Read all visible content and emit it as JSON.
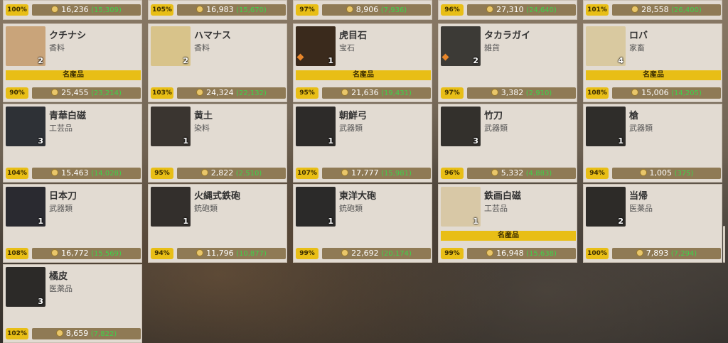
{
  "meisan_label": "名産品",
  "top_row": [
    {
      "pct": "100%",
      "price": "16,236",
      "base": "(15,309)"
    },
    {
      "pct": "105%",
      "price": "16,983",
      "base": "(15,670)"
    },
    {
      "pct": "97%",
      "price": "8,906",
      "base": "(7,936)"
    },
    {
      "pct": "96%",
      "price": "27,310",
      "base": "(24,640)"
    },
    {
      "pct": "101%",
      "price": "28,558",
      "base": "(26,400)"
    }
  ],
  "items": [
    {
      "name": "クチナシ",
      "cat": "香料",
      "count": "2",
      "meisan": true,
      "pct": "90%",
      "price": "25,455",
      "base": "(23,214)",
      "icon": "gardenia-icon",
      "color": "#c9a47a"
    },
    {
      "name": "ハマナス",
      "cat": "香料",
      "count": "2",
      "meisan": false,
      "pct": "103%",
      "price": "24,324",
      "base": "(22,132)",
      "icon": "rose-icon",
      "color": "#d8c38a"
    },
    {
      "name": "虎目石",
      "cat": "宝石",
      "count": "1",
      "meisan": true,
      "pct": "95%",
      "price": "21,636",
      "base": "(19,431)",
      "icon": "tigers-eye-icon",
      "color": "#3a2a1c"
    },
    {
      "name": "タカラガイ",
      "cat": "雑貨",
      "count": "2",
      "meisan": false,
      "pct": "97%",
      "price": "3,382",
      "base": "(2,910)",
      "icon": "cowrie-shell-icon",
      "color": "#3c3a36"
    },
    {
      "name": "ロバ",
      "cat": "家畜",
      "count": "4",
      "meisan": true,
      "pct": "108%",
      "price": "15,006",
      "base": "(14,205)",
      "icon": "donkey-icon",
      "color": "#d9c9a0"
    },
    {
      "name": "青華白磁",
      "cat": "工芸品",
      "count": "3",
      "meisan": false,
      "pct": "104%",
      "price": "15,463",
      "base": "(14,028)",
      "icon": "porcelain-vase-icon",
      "color": "#2e3136"
    },
    {
      "name": "黄土",
      "cat": "染料",
      "count": "1",
      "meisan": false,
      "pct": "95%",
      "price": "2,822",
      "base": "(2,510)",
      "icon": "ochre-icon",
      "color": "#3a3530"
    },
    {
      "name": "朝鮮弓",
      "cat": "武器類",
      "count": "1",
      "meisan": false,
      "pct": "107%",
      "price": "17,777",
      "base": "(15,981)",
      "icon": "bow-icon",
      "color": "#2d2b29"
    },
    {
      "name": "竹刀",
      "cat": "武器類",
      "count": "3",
      "meisan": false,
      "pct": "96%",
      "price": "5,332",
      "base": "(4,883)",
      "icon": "bamboo-sword-icon",
      "color": "#33302c"
    },
    {
      "name": "槍",
      "cat": "武器類",
      "count": "1",
      "meisan": false,
      "pct": "94%",
      "price": "1,005",
      "base": "(375)",
      "icon": "spear-icon",
      "color": "#2f2d2a"
    },
    {
      "name": "日本刀",
      "cat": "武器類",
      "count": "1",
      "meisan": false,
      "pct": "108%",
      "price": "16,772",
      "base": "(15,569)",
      "icon": "katana-icon",
      "color": "#2a2a30"
    },
    {
      "name": "火縄式鉄砲",
      "cat": "銃砲類",
      "count": "1",
      "meisan": false,
      "pct": "94%",
      "price": "11,796",
      "base": "(10,877)",
      "icon": "matchlock-icon",
      "color": "#332f2c"
    },
    {
      "name": "東洋大砲",
      "cat": "銃砲類",
      "count": "1",
      "meisan": false,
      "pct": "99%",
      "price": "22,692",
      "base": "(20,174)",
      "icon": "cannon-icon",
      "color": "#2b2a29"
    },
    {
      "name": "鉄画白磁",
      "cat": "工芸品",
      "count": "1",
      "meisan": true,
      "pct": "99%",
      "price": "16,948",
      "base": "(15,638)",
      "icon": "iron-painted-vase-icon",
      "color": "#d8c8a6"
    },
    {
      "name": "当帰",
      "cat": "医薬品",
      "count": "2",
      "meisan": false,
      "pct": "100%",
      "price": "7,893",
      "base": "(7,294)",
      "icon": "angelica-root-icon",
      "color": "#2d2b28"
    },
    {
      "name": "橘皮",
      "cat": "医薬品",
      "count": "3",
      "meisan": false,
      "pct": "102%",
      "price": "8,659",
      "base": "(7,822)",
      "icon": "citrus-peel-icon",
      "color": "#2c2a28"
    }
  ]
}
